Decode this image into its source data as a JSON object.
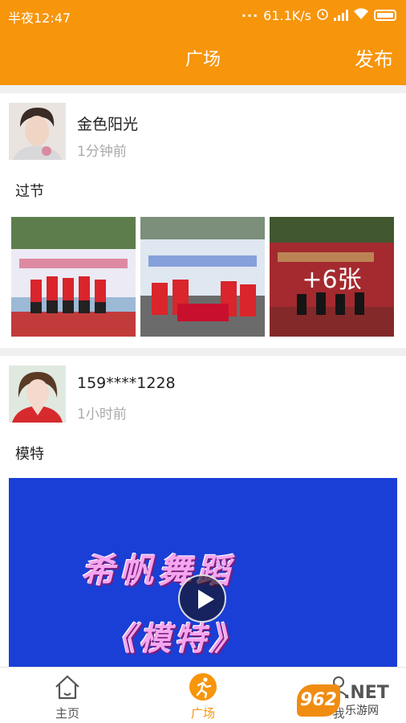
{
  "status": {
    "time": "半夜12:47",
    "dots": "···",
    "speed": "61.1K/s"
  },
  "nav": {
    "title": "广场",
    "publish": "发布"
  },
  "posts": [
    {
      "username": "金色阳光",
      "time": "1分钟前",
      "text": "过节",
      "more_photos": "+6张"
    },
    {
      "username": "159****1228",
      "time": "1小时前",
      "text": "模特",
      "video_title_line1": "希帆舞蹈",
      "video_title_line2": "《模特》"
    }
  ],
  "tabs": [
    {
      "label": "主页",
      "icon": "home-icon",
      "active": false
    },
    {
      "label": "广场",
      "icon": "plaza-icon",
      "active": true
    },
    {
      "label": "我",
      "icon": "profile-icon",
      "active": false
    }
  ],
  "watermark": {
    "badge": "962",
    "net": ".NET",
    "cn": "乐游网"
  },
  "colors": {
    "accent": "#f7950b",
    "video_bg": "#1a3fd6",
    "inactive_tab": "#555555"
  }
}
